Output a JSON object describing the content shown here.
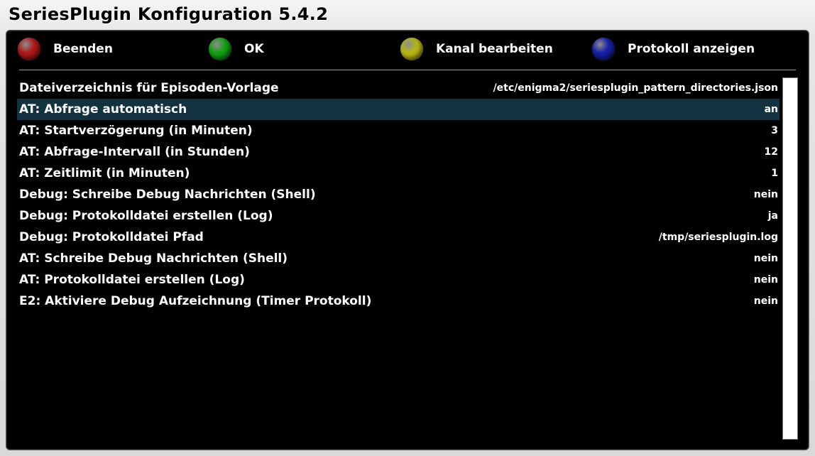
{
  "window": {
    "title": "SeriesPlugin Konfiguration 5.4.2"
  },
  "buttons": [
    {
      "label": "Beenden",
      "color": "#b01818",
      "icon": "red-button-icon"
    },
    {
      "label": "OK",
      "color": "#12a012",
      "icon": "green-button-icon"
    },
    {
      "label": "Kanal bearbeiten",
      "color": "#b8b814",
      "icon": "yellow-button-icon"
    },
    {
      "label": "Protokoll anzeigen",
      "color": "#1420a8",
      "icon": "blue-button-icon"
    }
  ],
  "settings": [
    {
      "label": "Dateiverzeichnis für Episoden-Vorlage",
      "value": "/etc/enigma2/seriesplugin_pattern_directories.json"
    },
    {
      "label": "AT: Abfrage automatisch",
      "value": "an"
    },
    {
      "label": "AT: Startverzögerung (in Minuten)",
      "value": "3"
    },
    {
      "label": "AT: Abfrage-Intervall (in Stunden)",
      "value": "12"
    },
    {
      "label": "AT: Zeitlimit (in Minuten)",
      "value": "1"
    },
    {
      "label": "Debug: Schreibe Debug Nachrichten (Shell)",
      "value": "nein"
    },
    {
      "label": "Debug: Protokolldatei erstellen (Log)",
      "value": "ja"
    },
    {
      "label": "Debug: Protokolldatei Pfad",
      "value": "/tmp/seriesplugin.log"
    },
    {
      "label": "AT: Schreibe Debug Nachrichten (Shell)",
      "value": "nein"
    },
    {
      "label": "AT: Protokolldatei erstellen (Log)",
      "value": "nein"
    },
    {
      "label": "E2: Aktiviere Debug Aufzeichnung (Timer Protokoll)",
      "value": "nein"
    }
  ],
  "selected_index": 1,
  "colors": {
    "selection": "#123240",
    "panel_background": "#000000",
    "text": "#ffffff"
  }
}
